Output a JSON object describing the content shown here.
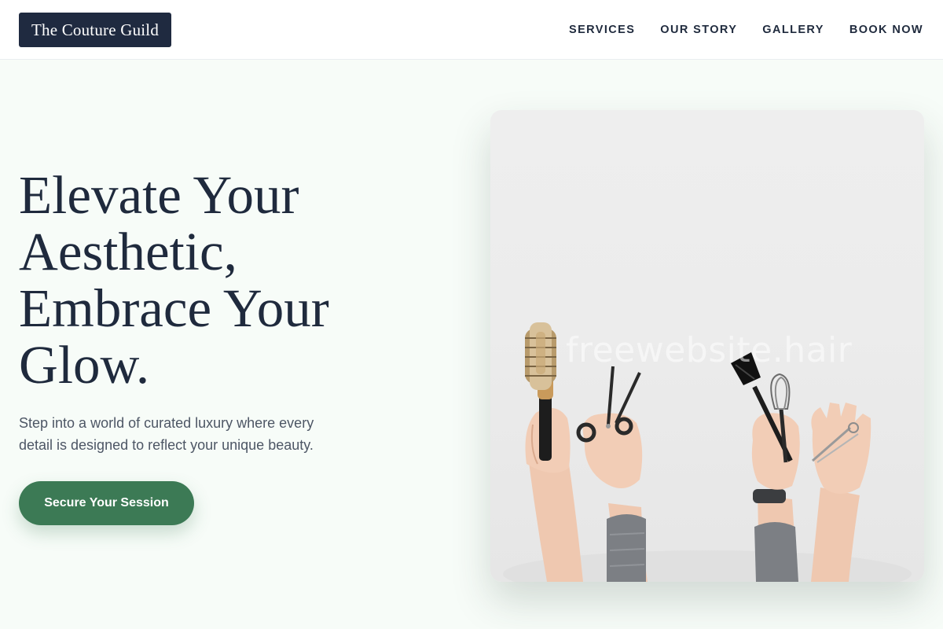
{
  "header": {
    "logo": "The Couture Guild",
    "nav": [
      {
        "label": "SERVICES"
      },
      {
        "label": "OUR STORY"
      },
      {
        "label": "GALLERY"
      },
      {
        "label": "BOOK NOW"
      }
    ]
  },
  "hero": {
    "title_lines": [
      "Elevate Your",
      "Aesthetic,",
      "Embrace Your",
      "Glow."
    ],
    "subtitle_lines": [
      "Step into a world of curated luxury where every",
      "detail is designed to reflect your unique beauty."
    ],
    "cta_label": "Secure Your Session",
    "image": {
      "watermark": "freewebsite.hair",
      "objects": [
        "round-brush-icon",
        "scissors-icon",
        "dye-brush-icon",
        "whisk-icon",
        "hair-clip-icon"
      ]
    }
  },
  "colors": {
    "background": "#f7fcf8",
    "header_bg": "#ffffff",
    "logo_bg": "#1f2a40",
    "text": "#1f2a3d",
    "accent": "#3c7a55"
  }
}
